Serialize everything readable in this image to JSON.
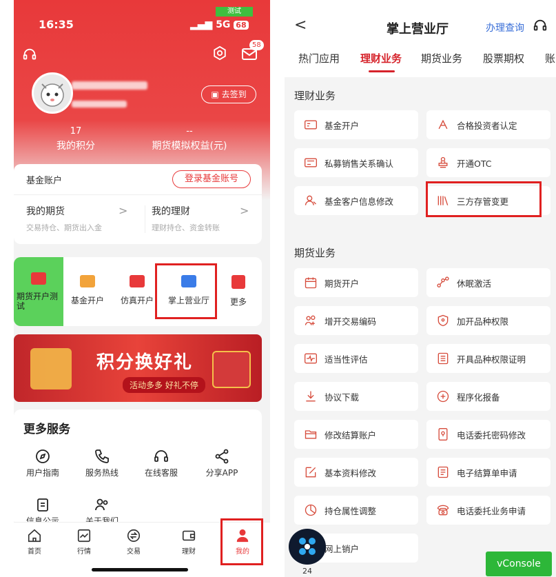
{
  "left": {
    "status": {
      "time": "16:35",
      "network": "5G",
      "battery": "68",
      "test_badge": "测试"
    },
    "message_count": "58",
    "checkin_label": "去签到",
    "stats": [
      {
        "value": "17",
        "label": "我的积分"
      },
      {
        "value": "--",
        "label": "期货模拟权益(元)"
      }
    ],
    "fund": {
      "title": "基金账户",
      "login_label": "登录基金账号"
    },
    "futures_card": {
      "title": "我的期货",
      "sub": "交易持仓、期货出入金",
      "arrow": ">"
    },
    "finance_card": {
      "title": "我的理财",
      "sub": "理财持仓、资金转账",
      "arrow": ">"
    },
    "quick": [
      {
        "label": "期货开户测试",
        "icon": "calendar-icon",
        "color": "#e8393a"
      },
      {
        "label": "基金开户",
        "icon": "id-card-icon",
        "color": "#f2a33a"
      },
      {
        "label": "仿真开户",
        "icon": "monitor-icon",
        "color": "#e8393a"
      },
      {
        "label": "掌上营业厅",
        "icon": "briefcase-icon",
        "color": "#3a7ce8"
      },
      {
        "label": "更多",
        "icon": "grid-icon",
        "color": "#e8393a"
      }
    ],
    "banner": {
      "title": "积分换好礼",
      "subtitle": "活动多多 好礼不停"
    },
    "services": {
      "title": "更多服务",
      "items": [
        {
          "label": "用户指南",
          "icon": "compass-icon"
        },
        {
          "label": "服务热线",
          "icon": "phone-icon"
        },
        {
          "label": "在线客服",
          "icon": "headset-icon"
        },
        {
          "label": "分享APP",
          "icon": "share-icon"
        },
        {
          "label": "信息公示",
          "icon": "clipboard-icon"
        },
        {
          "label": "关于我们",
          "icon": "users-icon"
        }
      ]
    },
    "tabbar": [
      {
        "label": "首页",
        "icon": "home-icon"
      },
      {
        "label": "行情",
        "icon": "chart-icon"
      },
      {
        "label": "交易",
        "icon": "exchange-icon"
      },
      {
        "label": "理财",
        "icon": "wallet-icon"
      },
      {
        "label": "我的",
        "icon": "user-icon"
      }
    ]
  },
  "right": {
    "header": {
      "title": "掌上营业厅",
      "query": "办理查询",
      "back": "<"
    },
    "tabs": [
      "热门应用",
      "理财业务",
      "期货业务",
      "股票期权",
      "账"
    ],
    "active_tab": "理财业务",
    "finance_title": "理财业务",
    "finance_items": [
      {
        "label": "基金开户",
        "icon": "id-card-icon"
      },
      {
        "label": "合格投资者认定",
        "icon": "badge-icon"
      },
      {
        "label": "私募销售关系确认",
        "icon": "vip-card-icon"
      },
      {
        "label": "开通OTC",
        "icon": "stamp-icon"
      },
      {
        "label": "基金客户信息修改",
        "icon": "user-edit-icon"
      },
      {
        "label": "三方存管变更",
        "icon": "books-icon"
      }
    ],
    "futures_title": "期货业务",
    "futures_items": [
      {
        "label": "期货开户",
        "icon": "calendar-icon"
      },
      {
        "label": "休眠激活",
        "icon": "nodes-icon"
      },
      {
        "label": "增开交易编码",
        "icon": "people-add-icon"
      },
      {
        "label": "加开品种权限",
        "icon": "shield-icon"
      },
      {
        "label": "适当性评估",
        "icon": "pulse-icon"
      },
      {
        "label": "开具品种权限证明",
        "icon": "list-icon"
      },
      {
        "label": "协议下载",
        "icon": "download-icon"
      },
      {
        "label": "程序化报备",
        "icon": "plus-circle-icon"
      },
      {
        "label": "修改结算账户",
        "icon": "folder-icon"
      },
      {
        "label": "电话委托密码修改",
        "icon": "phone-lock-icon"
      },
      {
        "label": "基本资料修改",
        "icon": "edit-icon"
      },
      {
        "label": "电子结算单申请",
        "icon": "document-icon"
      },
      {
        "label": "持仓属性调整",
        "icon": "pie-icon"
      },
      {
        "label": "电话委托业务申请",
        "icon": "telephone-icon"
      },
      {
        "label": "网上销户",
        "icon": "logout-icon"
      }
    ],
    "float_badge": "24",
    "vconsole": "vConsole"
  }
}
